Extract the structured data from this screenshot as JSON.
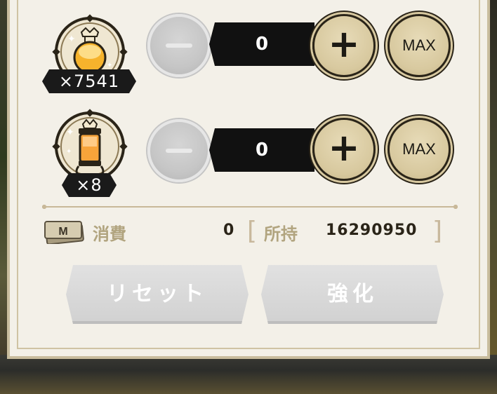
{
  "items": [
    {
      "name": "potion-flask",
      "count_text": "×7541",
      "quantity": "0"
    },
    {
      "name": "potion-lantern",
      "count_text": "×8",
      "quantity": "0"
    }
  ],
  "controls": {
    "max_label": "MAX"
  },
  "cost": {
    "label": "消費",
    "value": "0",
    "owned_label": "所持",
    "owned_value": "16290950",
    "bracket_open": "[",
    "bracket_close": "]",
    "currency_letter": "M"
  },
  "actions": {
    "reset": "リセット",
    "enhance": "強化"
  },
  "colors": {
    "accent": "#d8c99f",
    "panel": "#f3f0e8",
    "label": "#b1a47f",
    "button_disabled": "#d1d1d1"
  }
}
